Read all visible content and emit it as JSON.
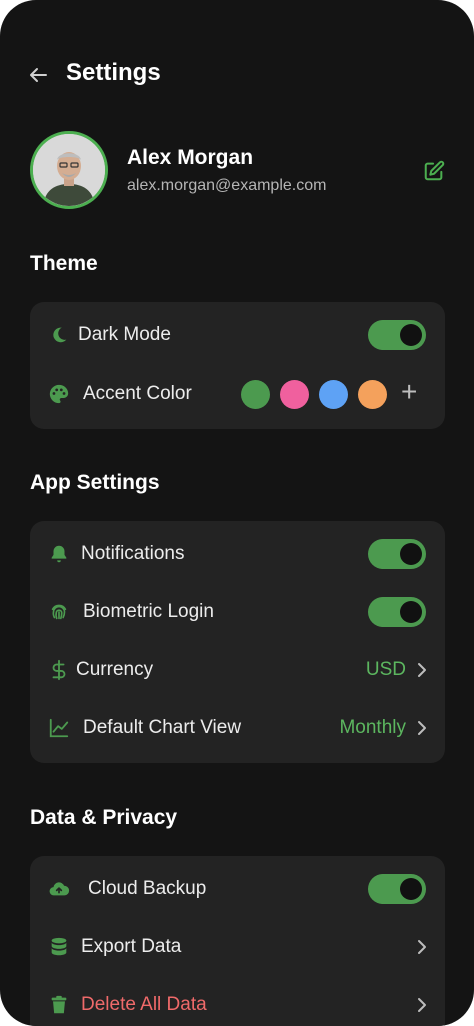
{
  "header": {
    "title": "Settings"
  },
  "profile": {
    "name": "Alex Morgan",
    "email": "alex.morgan@example.com"
  },
  "theme": {
    "section_title": "Theme",
    "dark_mode": {
      "label": "Dark Mode",
      "enabled": true
    },
    "accent": {
      "label": "Accent Color",
      "colors": [
        "#4c9a4f",
        "#f0609e",
        "#5ea2f5",
        "#f4a15c"
      ],
      "add_symbol": "+"
    }
  },
  "app_settings": {
    "section_title": "App Settings",
    "notifications": {
      "label": "Notifications",
      "enabled": true
    },
    "biometric": {
      "label": "Biometric Login",
      "enabled": true
    },
    "currency": {
      "label": "Currency",
      "value": "USD"
    },
    "chart_view": {
      "label": "Default Chart View",
      "value": "Monthly"
    }
  },
  "privacy": {
    "section_title": "Data & Privacy",
    "cloud_backup": {
      "label": "Cloud Backup",
      "enabled": true
    },
    "export": {
      "label": "Export Data"
    },
    "delete": {
      "label": "Delete All Data"
    }
  },
  "colors": {
    "accent": "#4c9a4f",
    "danger": "#ef6a6a",
    "background": "#141414",
    "card": "#232323"
  }
}
